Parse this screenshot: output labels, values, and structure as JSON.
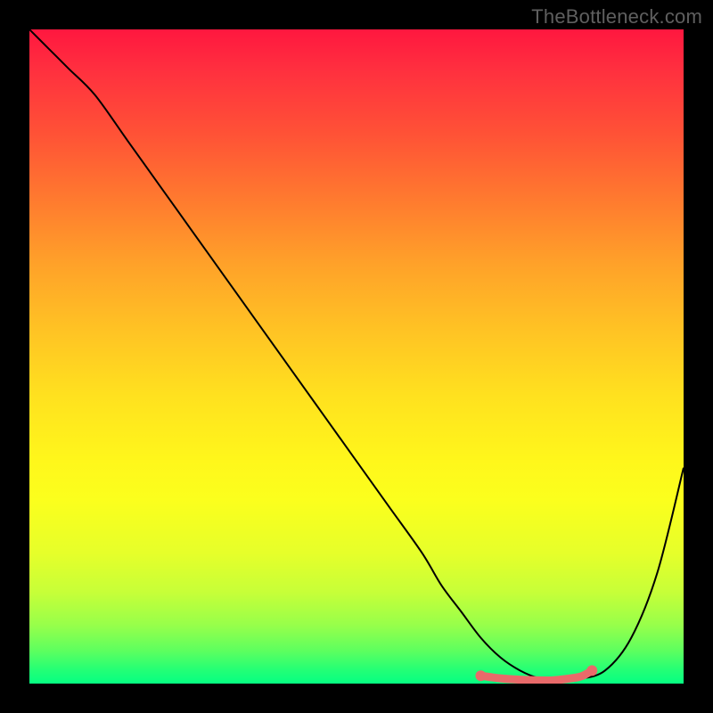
{
  "watermark": "TheBottleneck.com",
  "colors": {
    "background": "#000000",
    "curve": "#000000",
    "marker": "#e96a6a",
    "gradient_top": "#ff173f",
    "gradient_bottom": "#06ff82"
  },
  "chart_data": {
    "type": "line",
    "title": "",
    "xlabel": "",
    "ylabel": "",
    "xlim": [
      0,
      100
    ],
    "ylim": [
      0,
      100
    ],
    "x": [
      0,
      3,
      6,
      10,
      15,
      20,
      25,
      30,
      35,
      40,
      45,
      50,
      55,
      60,
      63,
      66,
      69,
      72,
      75,
      78,
      81,
      84,
      88,
      92,
      96,
      100
    ],
    "values": [
      100,
      97,
      94,
      90,
      83,
      76,
      69,
      62,
      55,
      48,
      41,
      34,
      27,
      20,
      15,
      11,
      7,
      4,
      2,
      0.8,
      0.5,
      0.7,
      2,
      7,
      17,
      33
    ],
    "series": [
      {
        "name": "curve",
        "x": [
          0,
          3,
          6,
          10,
          15,
          20,
          25,
          30,
          35,
          40,
          45,
          50,
          55,
          60,
          63,
          66,
          69,
          72,
          75,
          78,
          81,
          84,
          88,
          92,
          96,
          100
        ],
        "values": [
          100,
          97,
          94,
          90,
          83,
          76,
          69,
          62,
          55,
          48,
          41,
          34,
          27,
          20,
          15,
          11,
          7,
          4,
          2,
          0.8,
          0.5,
          0.7,
          2,
          7,
          17,
          33
        ]
      },
      {
        "name": "highlight-flat-region",
        "x": [
          69,
          72,
          75,
          78,
          80,
          82,
          84,
          85,
          86
        ],
        "values": [
          1.2,
          0.8,
          0.6,
          0.5,
          0.5,
          0.7,
          1.0,
          1.4,
          2.0
        ]
      }
    ]
  }
}
